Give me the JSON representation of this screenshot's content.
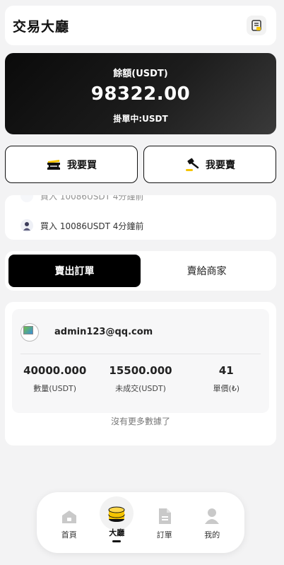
{
  "header": {
    "title": "交易大廳",
    "notebook_icon": "notebook-icon"
  },
  "balance": {
    "label": "餘額(USDT)",
    "amount": "98322.00",
    "pending": "掛單中:USDT"
  },
  "actions": {
    "buy": {
      "label": "我要買",
      "icon": "ticket-icon"
    },
    "sell": {
      "label": "我要賣",
      "icon": "auction-hammer-icon"
    }
  },
  "ticker": {
    "faded_text": "買入 10086USDT 4分鐘前",
    "text": "買入 10086USDT 4分鐘前"
  },
  "tabs": [
    {
      "label": "賣出訂單",
      "active": true
    },
    {
      "label": "賣給商家",
      "active": false
    }
  ],
  "order": {
    "email": "admin123@qq.com",
    "stats": [
      {
        "value": "40000.000",
        "label": "數量(USDT)"
      },
      {
        "value": "15500.000",
        "label": "未成交(USDT)"
      },
      {
        "value": "41",
        "label": "單價(₺)"
      }
    ]
  },
  "no_more": "沒有更多數據了",
  "nav": [
    {
      "label": "首頁",
      "icon": "home-icon",
      "active": false
    },
    {
      "label": "大廳",
      "icon": "coins-icon",
      "active": true
    },
    {
      "label": "訂單",
      "icon": "document-icon",
      "active": false
    },
    {
      "label": "我的",
      "icon": "user-icon",
      "active": false
    }
  ],
  "colors": {
    "accent": "#f5c400",
    "dark": "#000000",
    "background": "#f3f3f4"
  }
}
